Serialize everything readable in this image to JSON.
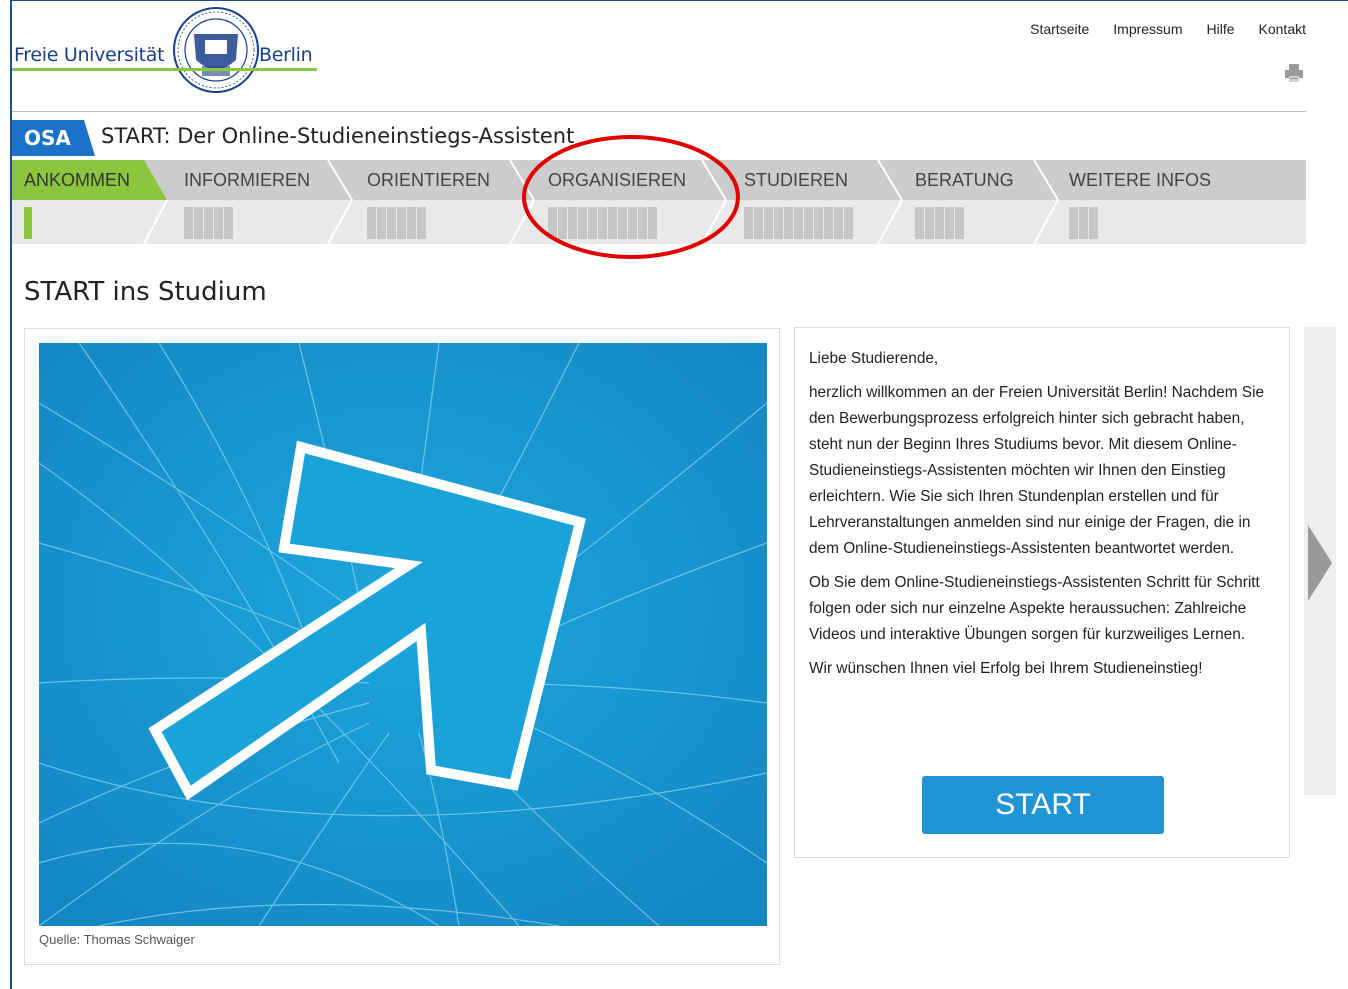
{
  "header": {
    "logo_left": "Freie Universität",
    "logo_right": "Berlin",
    "nav": [
      "Startseite",
      "Impressum",
      "Hilfe",
      "Kontakt"
    ],
    "print_icon": "printer-icon"
  },
  "titlebar": {
    "tag": "OSA",
    "title": "START: Der Online-Studieneinstiegs-Assistent"
  },
  "nav_tabs": [
    {
      "label": "ANKOMMEN",
      "active": true,
      "steps": 1
    },
    {
      "label": "INFORMIEREN",
      "active": false,
      "steps": 5
    },
    {
      "label": "ORIENTIEREN",
      "active": false,
      "steps": 6
    },
    {
      "label": "ORGANISIEREN",
      "active": false,
      "steps": 11
    },
    {
      "label": "STUDIEREN",
      "active": false,
      "steps": 11
    },
    {
      "label": "BERATUNG",
      "active": false,
      "steps": 5
    },
    {
      "label": "WEITERE INFOS",
      "active": false,
      "steps": 3
    }
  ],
  "main": {
    "heading": "START ins Studium",
    "image_caption": "Quelle: Thomas Schwaiger",
    "paragraphs": [
      "Liebe Studierende,",
      "herzlich willkommen an der Freien Universität Berlin! Nachdem Sie den Bewerbungsprozess erfolgreich hinter sich gebracht haben, steht nun der Beginn Ihres Studiums bevor. Mit diesem Online-Studieneinstiegs-Assistenten möchten wir Ihnen den Einstieg erleichtern. Wie Sie sich Ihren Stundenplan erstellen und für Lehrveranstaltungen anmelden sind nur einige der Fragen, die in dem Online-Studieneinstiegs-Assistenten beantwortet werden.",
      "Ob Sie dem Online-Studieneinstiegs-Assistenten Schritt für Schritt folgen oder sich nur einzelne Aspekte heraussuchen: Zahlreiche Videos und interaktive Übungen sorgen für kurzweiliges Lernen.",
      "Wir wünschen Ihnen viel Erfolg bei Ihrem Studieneinstieg!"
    ],
    "start_label": "START"
  },
  "colors": {
    "brand_blue": "#1a3f8a",
    "osa_blue": "#1a73c8",
    "active_green": "#8cc63f",
    "nav_gray": "#cfcfcf",
    "start_blue": "#2194d6",
    "annotation_red": "#e00000"
  }
}
